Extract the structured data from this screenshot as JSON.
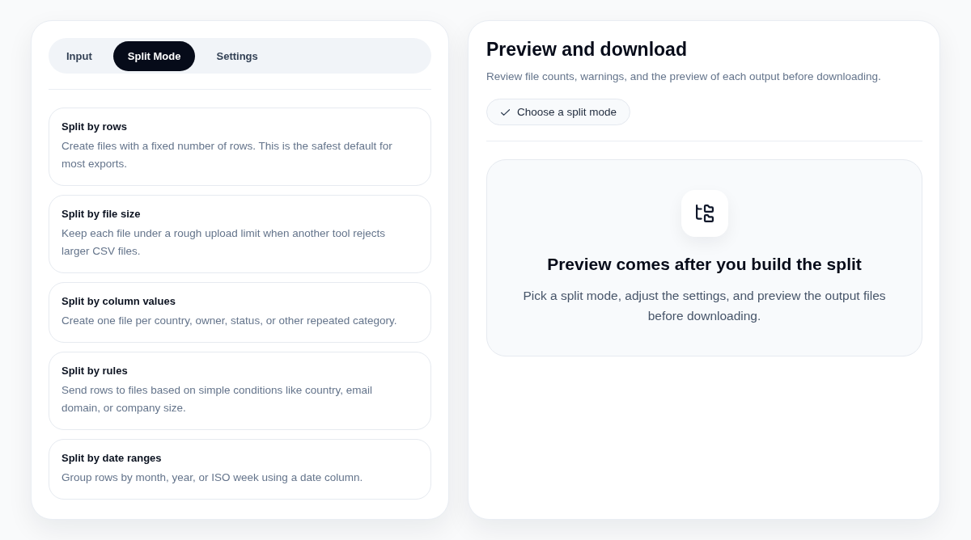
{
  "tabs": [
    {
      "label": "Input",
      "selected": false
    },
    {
      "label": "Split Mode",
      "selected": true
    },
    {
      "label": "Settings",
      "selected": false
    }
  ],
  "split_modes": [
    {
      "title": "Split by rows",
      "description": "Create files with a fixed number of rows. This is the safest default for most exports.",
      "selected": false
    },
    {
      "title": "Split by file size",
      "description": "Keep each file under a rough upload limit when another tool rejects larger CSV files.",
      "selected": false
    },
    {
      "title": "Split by column values",
      "description": "Create one file per country, owner, status, or other repeated category.",
      "selected": false
    },
    {
      "title": "Split by rules",
      "description": "Send rows to files based on simple conditions like country, email domain, or company size.",
      "selected": false
    },
    {
      "title": "Split by date ranges",
      "description": "Group rows by month, year, or ISO week using a date column.",
      "selected": false
    }
  ],
  "preview": {
    "title": "Preview and download",
    "subtitle": "Review file counts, warnings, and the preview of each output before downloading.",
    "status_chip": {
      "label": "Choose a split mode"
    },
    "empty_state": {
      "heading": "Preview comes after you build the split",
      "description": "Pick a split mode, adjust the settings, and preview the output files before downloading."
    }
  }
}
